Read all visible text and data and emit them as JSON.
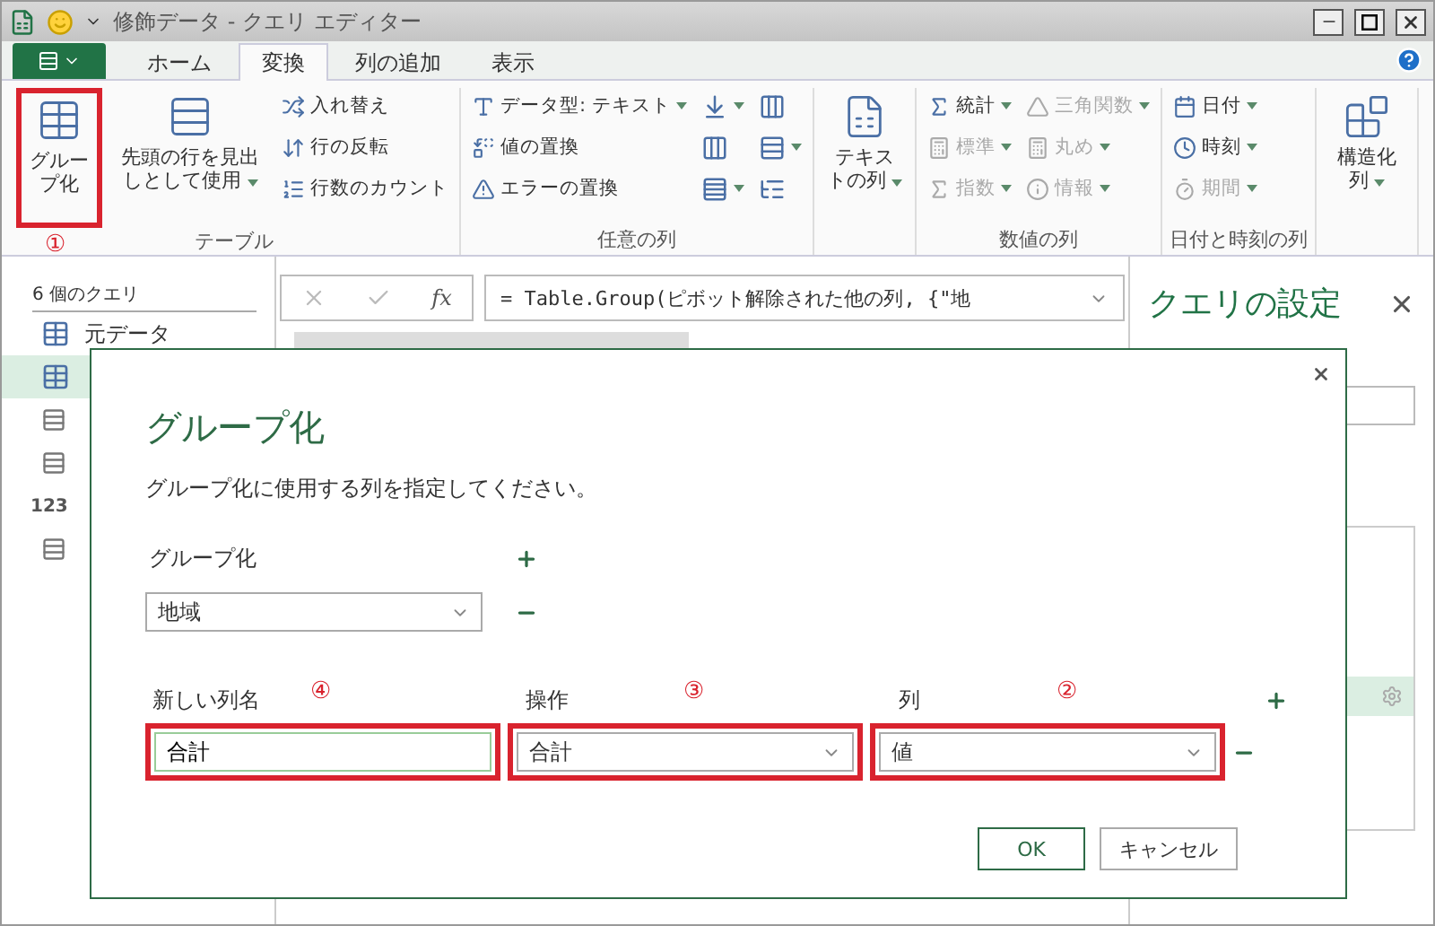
{
  "window": {
    "title": "修飾データ - クエリ エディター"
  },
  "tabs": [
    {
      "label": "ホーム",
      "selected": false
    },
    {
      "label": "変換",
      "selected": true
    },
    {
      "label": "列の追加",
      "selected": false
    },
    {
      "label": "表示",
      "selected": false
    }
  ],
  "ribbon": [
    {
      "label": "テーブル",
      "items": [
        {
          "kind": "large",
          "label": "グループ化",
          "dropdown": false,
          "highlighted": true,
          "marker": "①"
        },
        {
          "kind": "large",
          "label": "先頭の行を見出しとして使用",
          "dropdown": true,
          "highlighted": false
        },
        {
          "kind": "stack",
          "buttons": [
            {
              "label": "入れ替え",
              "dropdown": false,
              "disabled": false
            },
            {
              "label": "行の反転",
              "dropdown": false,
              "disabled": false
            },
            {
              "label": "行数のカウント",
              "dropdown": false,
              "disabled": false
            }
          ]
        }
      ]
    },
    {
      "label": "任意の列",
      "items": [
        {
          "kind": "stack",
          "buttons": [
            {
              "label": "データ型: テキスト",
              "dropdown": true,
              "disabled": false
            },
            {
              "label": "値の置換",
              "dropdown": false,
              "disabled": false
            },
            {
              "label": "エラーの置換",
              "dropdown": false,
              "disabled": false
            }
          ]
        },
        {
          "kind": "icons",
          "buttons": [
            {
              "dropdown": true
            },
            {
              "dropdown": false
            },
            {
              "dropdown": true
            }
          ]
        },
        {
          "kind": "icons",
          "buttons": [
            {
              "dropdown": false
            },
            {
              "dropdown": true
            },
            {
              "dropdown": false
            }
          ]
        }
      ]
    },
    {
      "items": [
        {
          "kind": "large",
          "label": "テキストの列",
          "dropdown": true,
          "highlighted": false
        }
      ]
    },
    {
      "label": "数値の列",
      "items": [
        {
          "kind": "stack",
          "buttons": [
            {
              "label": "統計",
              "dropdown": true,
              "disabled": false
            },
            {
              "label": "標準",
              "dropdown": true,
              "disabled": true
            },
            {
              "label": "指数",
              "dropdown": true,
              "disabled": true
            }
          ]
        },
        {
          "kind": "stack",
          "buttons": [
            {
              "label": "三角関数",
              "dropdown": true,
              "disabled": true
            },
            {
              "label": "丸め",
              "dropdown": true,
              "disabled": true
            },
            {
              "label": "情報",
              "dropdown": true,
              "disabled": true
            }
          ]
        }
      ]
    },
    {
      "label": "日付と時刻の列",
      "items": [
        {
          "kind": "stack",
          "buttons": [
            {
              "label": "日付",
              "dropdown": true,
              "disabled": false
            },
            {
              "label": "時刻",
              "dropdown": true,
              "disabled": false
            },
            {
              "label": "期間",
              "dropdown": true,
              "disabled": true
            }
          ]
        }
      ]
    },
    {
      "items": [
        {
          "kind": "large",
          "label": "構造化列",
          "dropdown": true,
          "highlighted": false
        }
      ]
    }
  ],
  "queries": {
    "title": "6 個のクエリ",
    "items": [
      {
        "kind": "table",
        "label": "元データ",
        "selected": false
      },
      {
        "kind": "table",
        "selected": true
      },
      {
        "kind": "list",
        "selected": false
      },
      {
        "kind": "list",
        "selected": false
      },
      {
        "kind": "number",
        "badge": "123",
        "selected": false
      },
      {
        "kind": "list",
        "selected": false
      }
    ]
  },
  "formula_bar": {
    "fx": "fx",
    "formula": "= Table.Group(ピボット解除された他の列, {\"地"
  },
  "settings": {
    "title": "クエリの設定"
  },
  "dialog": {
    "title": "グループ化",
    "description": "グループ化に使用する列を指定してください。",
    "group_by": {
      "label": "グループ化",
      "value": "地域"
    },
    "columns": [
      {
        "kind": "text",
        "label": "新しい列名",
        "marker": "④",
        "value": "合計",
        "highlighted": true
      },
      {
        "kind": "select",
        "label": "操作",
        "marker": "③",
        "value": "合計",
        "highlighted": true
      },
      {
        "kind": "select",
        "label": "列",
        "marker": "②",
        "value": "値",
        "highlighted": true
      }
    ],
    "buttons": [
      {
        "label": "OK",
        "primary": true
      },
      {
        "label": "キャンセル",
        "primary": false
      }
    ]
  }
}
